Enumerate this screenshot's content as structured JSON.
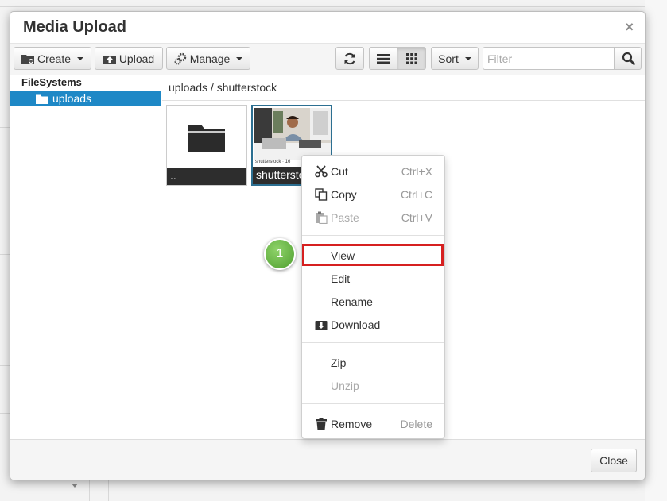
{
  "dialog": {
    "title": "Media Upload",
    "close_glyph": "×"
  },
  "toolbar": {
    "create_label": "Create",
    "upload_label": "Upload",
    "manage_label": "Manage",
    "sort_label": "Sort",
    "filter_placeholder": "Filter",
    "icons": [
      "folder-plus-icon",
      "upload-icon",
      "gears-icon",
      "refresh-icon",
      "list-view-icon",
      "grid-view-icon",
      "search-icon"
    ]
  },
  "tree": {
    "root_label": "FileSystems",
    "items": [
      {
        "label": "uploads",
        "selected": true
      }
    ]
  },
  "breadcrumb": "uploads / shutterstock",
  "tiles": [
    {
      "label": "..",
      "type": "folder"
    },
    {
      "label": "shutterstock",
      "type": "image",
      "thumb_caption": "shutterstock · 16",
      "selected": true
    }
  ],
  "context_menu": {
    "cut": {
      "label": "Cut",
      "shortcut": "Ctrl+X"
    },
    "copy": {
      "label": "Copy",
      "shortcut": "Ctrl+C"
    },
    "paste": {
      "label": "Paste",
      "shortcut": "Ctrl+V",
      "disabled": true
    },
    "view": {
      "label": "View",
      "highlighted": true
    },
    "edit": {
      "label": "Edit"
    },
    "rename": {
      "label": "Rename"
    },
    "download": {
      "label": "Download"
    },
    "zip": {
      "label": "Zip"
    },
    "unzip": {
      "label": "Unzip",
      "disabled": true
    },
    "remove": {
      "label": "Remove",
      "shortcut": "Delete"
    }
  },
  "step_badge": "1",
  "footer": {
    "close_label": "Close"
  },
  "colors": {
    "selection": "#1e88c6",
    "highlight": "#d62020",
    "badge": "#5fae3a"
  }
}
